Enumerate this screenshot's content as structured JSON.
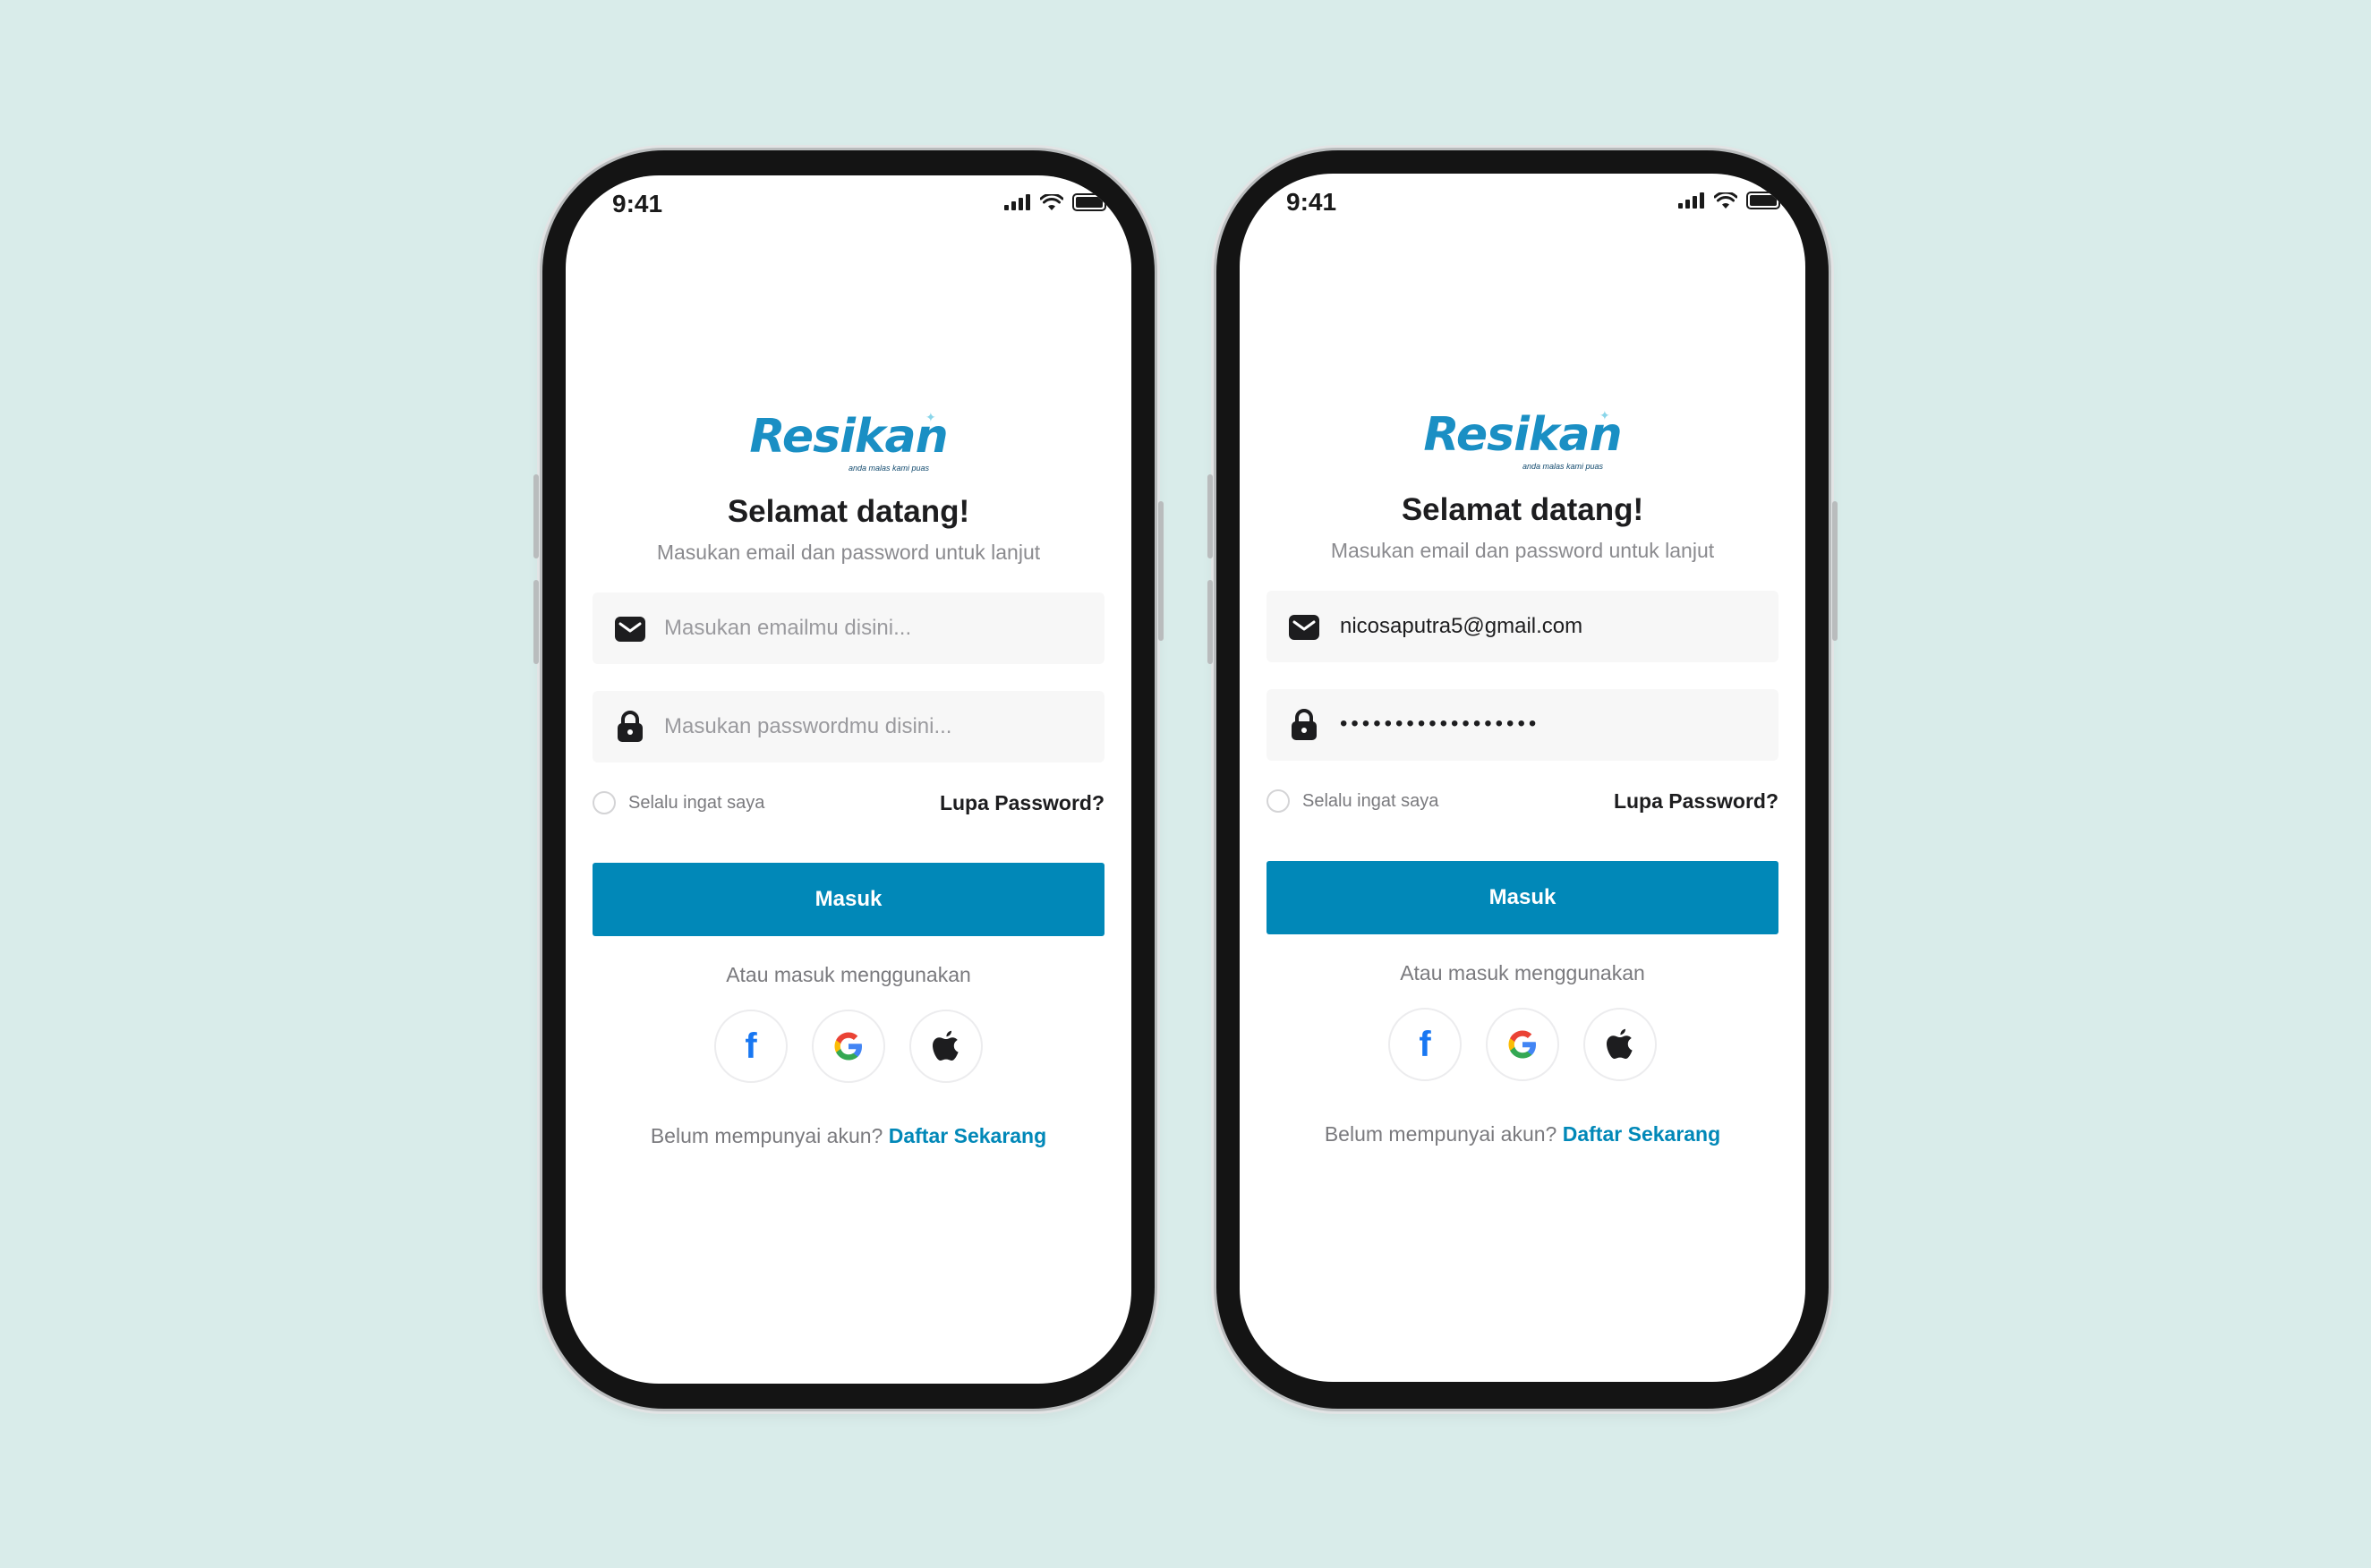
{
  "screens": [
    {
      "status_time": "9:41",
      "logo_text": "Resikan",
      "logo_tagline": "anda malas kami puas",
      "title": "Selamat datang!",
      "subtitle": "Masukan email dan password untuk lanjut",
      "email_placeholder": "Masukan emailmu disini...",
      "email_value": "",
      "password_placeholder": "Masukan passwordmu disini...",
      "password_dots": "",
      "remember_label": "Selalu ingat saya",
      "forgot_label": "Lupa Password?",
      "login_label": "Masuk",
      "alt_login_text": "Atau masuk menggunakan",
      "register_prompt": "Belum mempunyai akun?",
      "register_link": "Daftar Sekarang"
    },
    {
      "status_time": "9:41",
      "logo_text": "Resikan",
      "logo_tagline": "anda malas kami puas",
      "title": "Selamat datang!",
      "subtitle": "Masukan email dan password untuk lanjut",
      "email_placeholder": "",
      "email_value": "nicosaputra5@gmail.com",
      "password_placeholder": "",
      "password_dots": "••••••••••••••••••",
      "remember_label": "Selalu ingat saya",
      "forgot_label": "Lupa Password?",
      "login_label": "Masuk",
      "alt_login_text": "Atau masuk menggunakan",
      "register_prompt": "Belum mempunyai akun?",
      "register_link": "Daftar Sekarang"
    }
  ],
  "icons": {
    "email": "envelope-icon",
    "password": "lock-icon",
    "facebook": "facebook-icon",
    "google": "google-icon",
    "apple": "apple-icon"
  },
  "colors": {
    "background": "#d9ecea",
    "primary": "#0188b8",
    "logo": "#1a8fc4",
    "facebook": "#1877f2"
  }
}
